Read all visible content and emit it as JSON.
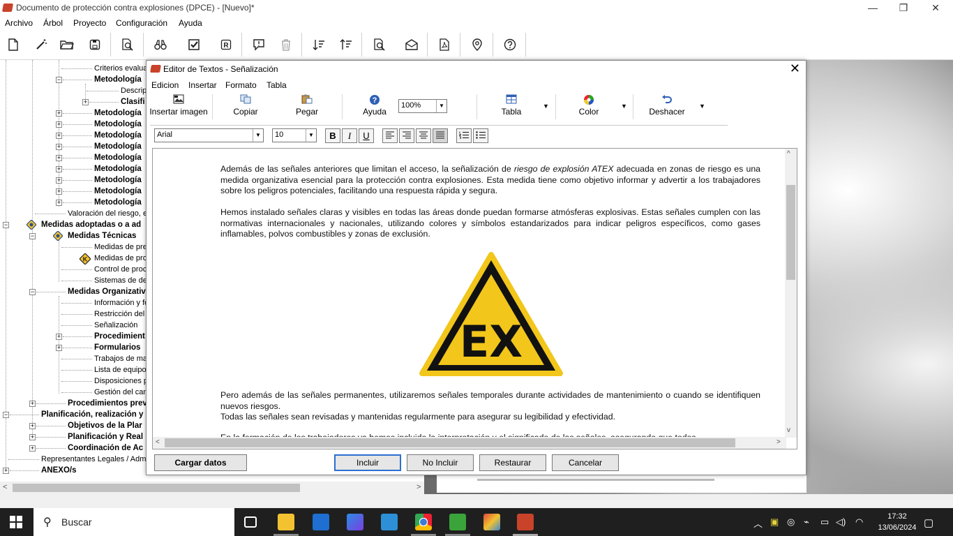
{
  "window": {
    "title": "Documento de protección contra explosiones (DPCE) - [Nuevo]*",
    "minimize": "—",
    "restore": "❐",
    "close": "✕"
  },
  "menu": [
    "Archivo",
    "Árbol",
    "Proyecto",
    "Configuración",
    "Ayuda"
  ],
  "toolbar_icons": [
    "new-document-icon",
    "wand-icon",
    "open-folder-icon",
    "save-icon",
    "preview-icon",
    "binoculars-icon",
    "checkbox-icon",
    "r-icon",
    "comment-icon",
    "trash-icon",
    "sort-down-icon",
    "sort-up-icon",
    "search-doc-icon",
    "envelope-icon",
    "pdf-icon",
    "location-icon",
    "help-icon"
  ],
  "tree": [
    {
      "label": "Criterios evaluac",
      "bold": false
    },
    {
      "label": "Metodología",
      "bold": true
    },
    {
      "label": "Descrip",
      "bold": false
    },
    {
      "label": "Clasifi",
      "bold": true
    },
    {
      "label": "Metodología",
      "bold": true
    },
    {
      "label": "Metodología",
      "bold": true
    },
    {
      "label": "Metodología",
      "bold": true
    },
    {
      "label": "Metodología",
      "bold": true
    },
    {
      "label": "Metodología",
      "bold": true
    },
    {
      "label": "Metodología",
      "bold": true
    },
    {
      "label": "Metodología",
      "bold": true
    },
    {
      "label": "Metodología",
      "bold": true
    },
    {
      "label": "Metodología",
      "bold": true
    },
    {
      "label": "Valoración del riesgo, e",
      "bold": false
    },
    {
      "label": "Medidas adoptadas o a ad",
      "bold": true
    },
    {
      "label": "Medidas Técnicas",
      "bold": true
    },
    {
      "label": "Medidas de pre",
      "bold": false
    },
    {
      "label": "Medidas de pro",
      "bold": false
    },
    {
      "label": "Control de proc",
      "bold": false
    },
    {
      "label": "Sistemas de det",
      "bold": false
    },
    {
      "label": "Medidas Organizativ",
      "bold": true
    },
    {
      "label": "Información y fo",
      "bold": false
    },
    {
      "label": "Restricción del",
      "bold": false
    },
    {
      "label": "Señalización",
      "bold": false
    },
    {
      "label": "Procedimient",
      "bold": true
    },
    {
      "label": "Formularios",
      "bold": true
    },
    {
      "label": "Trabajos de ma",
      "bold": false
    },
    {
      "label": "Lista de equipos",
      "bold": false
    },
    {
      "label": "Disposiciones p",
      "bold": false
    },
    {
      "label": "Gestión del cam",
      "bold": false
    },
    {
      "label": "Procedimientos prev",
      "bold": true
    },
    {
      "label": "Planificación, realización y",
      "bold": true
    },
    {
      "label": "Objetivos de la Plar",
      "bold": true
    },
    {
      "label": "Planificación y Real",
      "bold": true
    },
    {
      "label": "Coordinación de Ac",
      "bold": true
    },
    {
      "label": "Representantes Legales / Admi",
      "bold": false
    },
    {
      "label": "ANEXO/s",
      "bold": true
    }
  ],
  "editor": {
    "title": "Editor de Textos - Señalización",
    "menu": [
      "Edicion",
      "Insertar",
      "Formato",
      "Tabla"
    ],
    "ribbon": {
      "insert_image": "Insertar imagen",
      "copy": "Copiar",
      "paste": "Pegar",
      "help": "Ayuda",
      "zoom": "100%",
      "table": "Tabla",
      "color": "Color",
      "undo": "Deshacer"
    },
    "font": "Arial",
    "font_size": "10",
    "format_buttons": {
      "bold": "B",
      "italic": "I",
      "underline": "U"
    },
    "paragraphs": {
      "p1_a": "Además de las señales anteriores que limitan el acceso, la señalización de ",
      "p1_em": "riesgo de explosión ATEX",
      "p1_b": " adecuada en zonas de riesgo es una medida organizativa esencial para la protección contra explosiones. Esta medida tiene como objetivo informar y advertir a los trabajadores sobre los peligros potenciales, facilitando una respuesta rápida y segura.",
      "p2": "Hemos instalado señales claras y visibles en todas las áreas donde puedan formarse atmósferas explosivas. Estas señales cumplen con las normativas internacionales y nacionales, utilizando colores y símbolos estandarizados para indicar peligros específicos, como gases inflamables, polvos combustibles y zonas de exclusión.",
      "sign_text": "EX",
      "p3": "Pero además de las señales permanentes, utilizaremos señales temporales durante actividades de mantenimiento o cuando se identifiquen nuevos riesgos.",
      "p4": "Todas las señales sean revisadas y mantenidas regularmente para asegurar su legibilidad y efectividad.",
      "p5": "En la formación de los trabajadores ya hemos incluido la interpretación y el significado de las señales, asegurando que todos"
    },
    "buttons": {
      "load": "Cargar datos",
      "include": "Incluir",
      "not_include": "No Incluir",
      "restore": "Restaurar",
      "cancel": "Cancelar"
    }
  },
  "taskbar": {
    "search": "Buscar",
    "time": "17:32",
    "date": "13/06/2024"
  }
}
